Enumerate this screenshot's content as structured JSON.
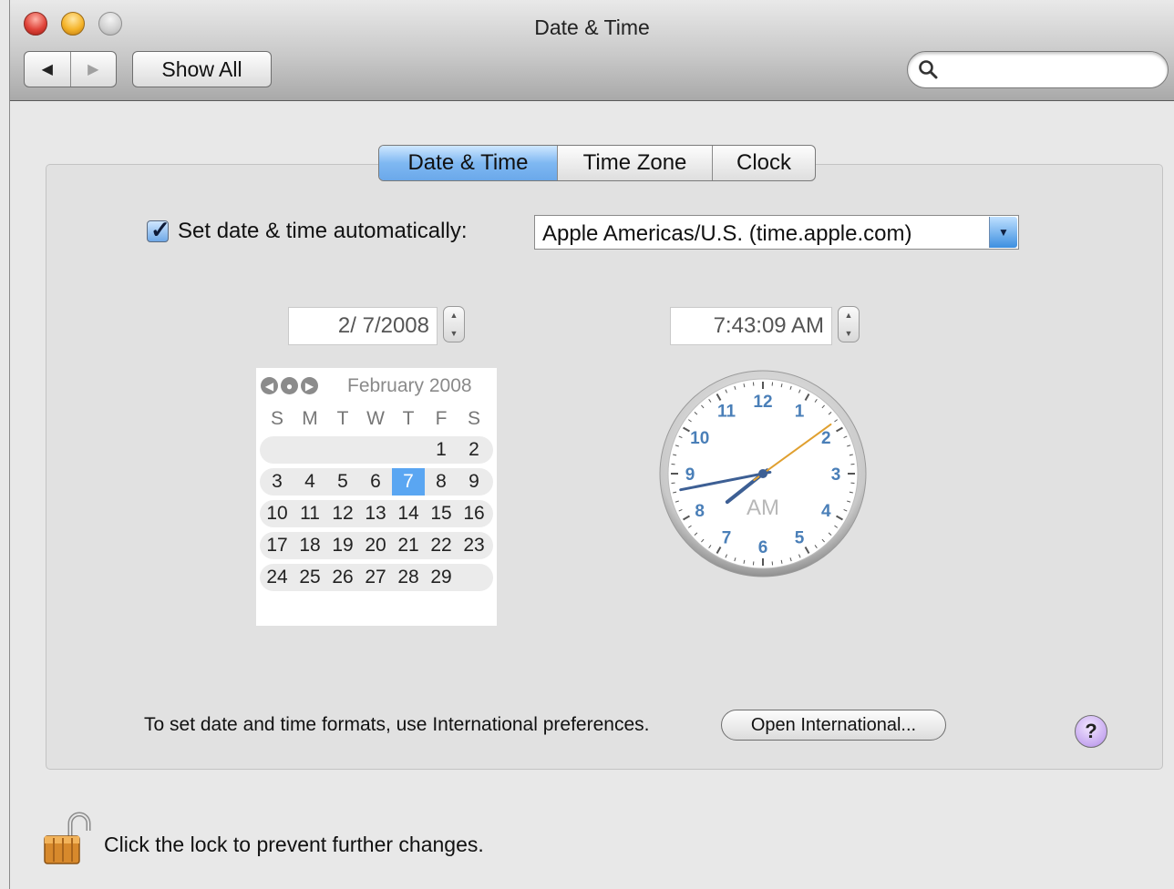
{
  "window": {
    "title": "Date & Time"
  },
  "toolbar": {
    "back_glyph": "◀",
    "forward_glyph": "▶",
    "show_all_label": "Show All",
    "search_placeholder": "",
    "search_icon": "magnifier-icon"
  },
  "tabs": [
    {
      "label": "Date & Time",
      "selected": true
    },
    {
      "label": "Time Zone",
      "selected": false
    },
    {
      "label": "Clock",
      "selected": false
    }
  ],
  "auto_time": {
    "checked": true,
    "label": "Set date & time automatically:",
    "server": "Apple Americas/U.S. (time.apple.com)"
  },
  "date_field": {
    "value": "2/  7/2008"
  },
  "time_field": {
    "value": "7:43:09 AM"
  },
  "calendar": {
    "month_title": "February 2008",
    "nav_glyphs": [
      "◀",
      "●",
      "▶"
    ],
    "weekdays": [
      "S",
      "M",
      "T",
      "W",
      "T",
      "F",
      "S"
    ],
    "weeks": [
      [
        "",
        "",
        "",
        "",
        "",
        "1",
        "2"
      ],
      [
        "3",
        "4",
        "5",
        "6",
        "7",
        "8",
        "9"
      ],
      [
        "10",
        "11",
        "12",
        "13",
        "14",
        "15",
        "16"
      ],
      [
        "17",
        "18",
        "19",
        "20",
        "21",
        "22",
        "23"
      ],
      [
        "24",
        "25",
        "26",
        "27",
        "28",
        "29",
        ""
      ]
    ],
    "selected_day": "7"
  },
  "clock": {
    "hour": 7,
    "minute": 43,
    "second": 9,
    "period": "AM",
    "numerals": [
      "12",
      "1",
      "2",
      "3",
      "4",
      "5",
      "6",
      "7",
      "8",
      "9",
      "10",
      "11"
    ],
    "numeral_color": "#4a7fb8"
  },
  "footer": {
    "intl_text": "To set date and time formats, use International preferences.",
    "open_intl_label": "Open International...",
    "help_label": "?"
  },
  "lock": {
    "text": "Click the lock to prevent further changes.",
    "icon": "unlocked-padlock-icon"
  }
}
